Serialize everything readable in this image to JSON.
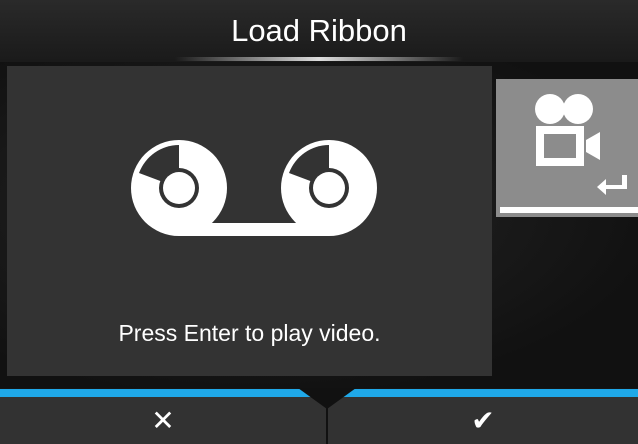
{
  "header": {
    "title": "Load Ribbon"
  },
  "main": {
    "message": "Press Enter to play video.",
    "illustration": "ribbon-rolls-icon"
  },
  "side": {
    "video_button": {
      "icon": "video-camera-icon",
      "enter_icon": "enter-return-icon"
    }
  },
  "softkeys": {
    "cancel": {
      "icon": "close-icon",
      "glyph": "✕"
    },
    "confirm": {
      "icon": "checkmark-icon",
      "glyph": "✔"
    }
  },
  "colors": {
    "accent": "#1fa8e8",
    "panel": "#333333",
    "button": "#8c8c8c",
    "background": "#151515"
  }
}
